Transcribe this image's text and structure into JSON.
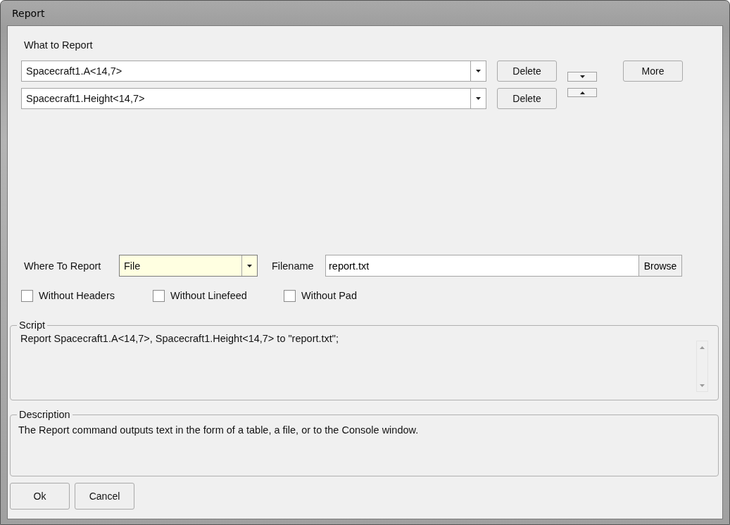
{
  "window": {
    "title": "Report"
  },
  "what_to_report": {
    "label": "What to Report",
    "items": [
      {
        "value": "Spacecraft1.A<14,7>",
        "delete": "Delete"
      },
      {
        "value": "Spacecraft1.Height<14,7>",
        "delete": "Delete"
      }
    ],
    "more": "More"
  },
  "where_to_report": {
    "label": "Where To Report",
    "value": "File"
  },
  "filename": {
    "label": "Filename",
    "value": "report.txt",
    "browse": "Browse"
  },
  "options": [
    {
      "label": "Without Headers",
      "checked": false
    },
    {
      "label": "Without Linefeed",
      "checked": false
    },
    {
      "label": "Without Pad",
      "checked": false
    }
  ],
  "script": {
    "title": "Script",
    "text": "Report Spacecraft1.A<14,7>, Spacecraft1.Height<14,7> to \"report.txt\";"
  },
  "description": {
    "title": "Description",
    "text": "The Report command outputs text in the form of a table, a file, or to the Console window."
  },
  "buttons": [
    {
      "label": "Ok"
    },
    {
      "label": "Cancel"
    }
  ]
}
